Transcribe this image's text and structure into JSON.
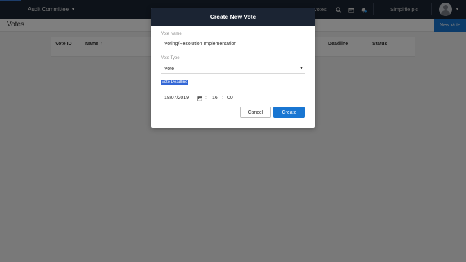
{
  "topbar": {
    "committee": "Audit Committee",
    "votes_link": "Votes",
    "org_name": "Simplifie plc",
    "icons": [
      "search-icon",
      "calendar-icon",
      "notifications-icon",
      "avatar"
    ]
  },
  "page": {
    "title": "Votes",
    "new_vote_button": "New Vote"
  },
  "table": {
    "columns": [
      "Vote ID",
      "Name",
      "Deadline",
      "Status"
    ],
    "sort_indicator": "↑"
  },
  "modal": {
    "title": "Create New Vote",
    "vote_name_label": "Vote Name",
    "vote_name_value": "Voting/Resolution Implementation",
    "vote_type_label": "Vote Type",
    "vote_type_value": "Vote",
    "vote_deadline_label": "Vote Deadline",
    "deadline_date": "18/07/2019",
    "deadline_hour": "16",
    "deadline_minute": "00",
    "time_separator": ":",
    "cancel_label": "Cancel",
    "create_label": "Create"
  },
  "colors": {
    "topbar_bg": "#1b2433",
    "primary": "#1976d2",
    "selection": "#3367d6"
  }
}
